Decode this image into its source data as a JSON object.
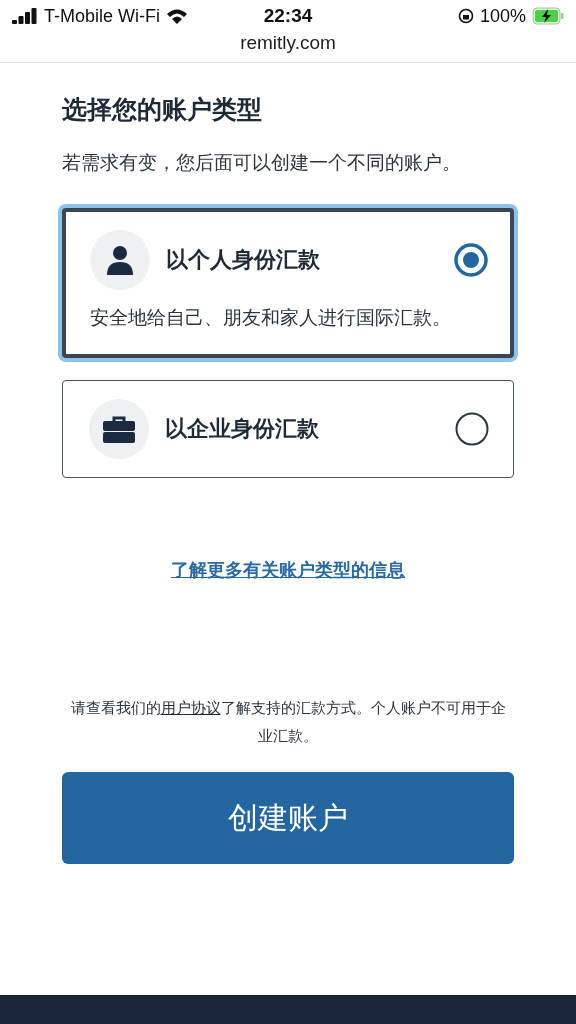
{
  "status_bar": {
    "carrier": "T-Mobile Wi-Fi",
    "time": "22:34",
    "battery": "100%"
  },
  "address_bar": {
    "url": "remitly.com"
  },
  "heading": "选择您的账户类型",
  "subtitle": "若需求有变，您后面可以创建一个不同的账户。",
  "options": [
    {
      "kind": "person",
      "title": "以个人身份汇款",
      "description": "安全地给自己、朋友和家人进行国际汇款。",
      "selected": true
    },
    {
      "kind": "business",
      "title": "以企业身份汇款",
      "selected": false
    }
  ],
  "learn_more_link": "了解更多有关账户类型的信息",
  "notice": {
    "before": "请查看我们的",
    "link": "用户协议",
    "after": "了解支持的汇款方式。个人账户不可用于企业汇款。"
  },
  "create_button": "创建账户"
}
